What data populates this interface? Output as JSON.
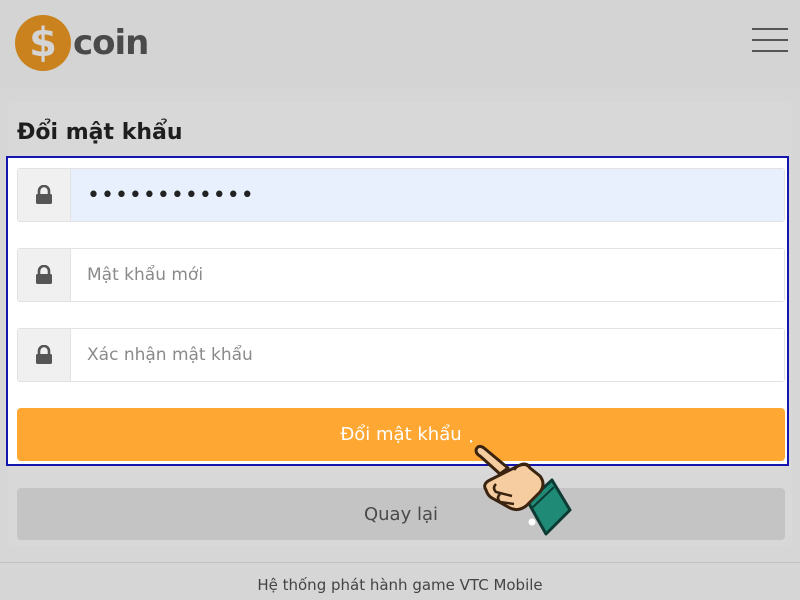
{
  "header": {
    "logo_symbol": "$",
    "logo_text": "coin",
    "menu_icon": "hamburger-menu-icon"
  },
  "page": {
    "title": "Đổi mật khẩu"
  },
  "form": {
    "current_password": {
      "value": "••••••••••••",
      "icon": "lock-icon"
    },
    "new_password": {
      "placeholder": "Mật khẩu mới",
      "icon": "lock-icon"
    },
    "confirm_password": {
      "placeholder": "Xác nhận mật khẩu",
      "icon": "lock-icon"
    },
    "submit_label": "Đổi mật khẩu"
  },
  "back_label": "Quay lại",
  "footer": {
    "text": "Hệ thống phát hành game VTC Mobile"
  },
  "colors": {
    "accent": "#ffa733",
    "highlight_border": "#1515b0",
    "autofill_bg": "#e8f0fe",
    "logo_coin": "#c9821e"
  }
}
